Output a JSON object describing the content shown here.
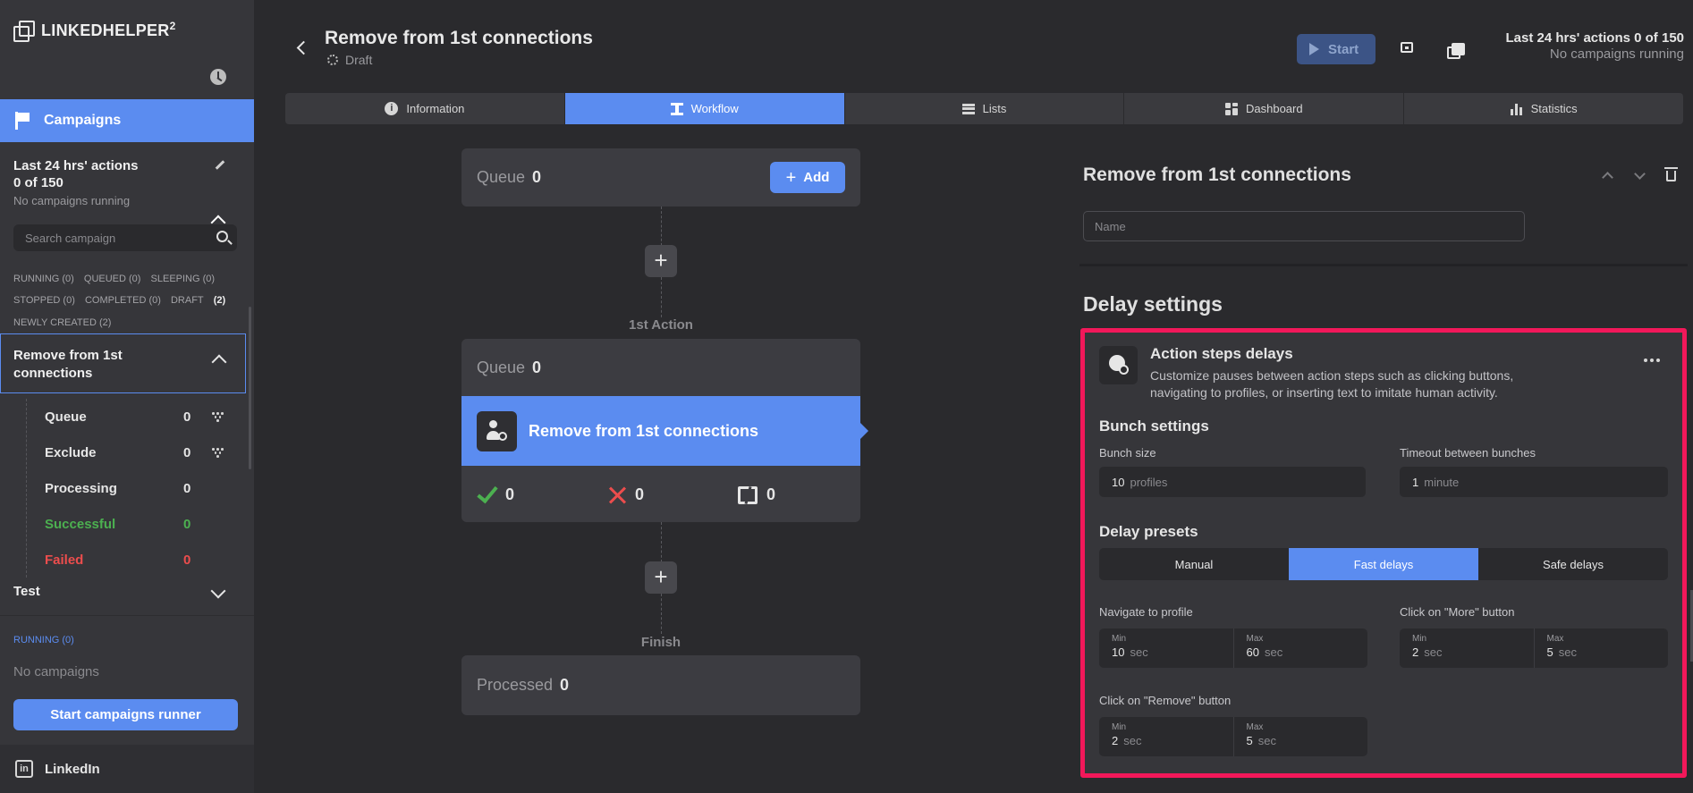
{
  "sidebar": {
    "logo": "LINKEDHELPER",
    "logo_sup": "2",
    "campaigns_label": "Campaigns",
    "stats_title": "Last 24 hrs' actions",
    "stats_count": "0 of 150",
    "stats_status": "No campaigns running",
    "search_placeholder": "Search campaign",
    "filters": {
      "running": "RUNNING (0)",
      "queued": "QUEUED (0)",
      "sleeping": "SLEEPING (0)",
      "stopped": "STOPPED (0)",
      "completed": "COMPLETED (0)",
      "draft": "DRAFT",
      "draft_count": "(2)"
    },
    "newly_created": "NEWLY CREATED (2)",
    "campaign_title": "Remove from 1st connections",
    "sub_items": [
      {
        "label": "Queue",
        "count": "0"
      },
      {
        "label": "Exclude",
        "count": "0"
      },
      {
        "label": "Processing",
        "count": "0"
      },
      {
        "label": "Successful",
        "count": "0"
      },
      {
        "label": "Failed",
        "count": "0"
      }
    ],
    "test_campaign": "Test",
    "running_label": "RUNNING (0)",
    "no_campaigns": "No campaigns",
    "runner_button": "Start campaigns runner",
    "linkedin_label": "LinkedIn",
    "linkedin_icon_text": "in"
  },
  "header": {
    "title": "Remove from 1st connections",
    "status": "Draft",
    "start_button": "Start",
    "stats_line1": "Last 24 hrs' actions 0 of 150",
    "stats_line2": "No campaigns running"
  },
  "tabs": [
    {
      "label": "Information",
      "icon": "info-icon"
    },
    {
      "label": "Workflow",
      "icon": "workflow-icon"
    },
    {
      "label": "Lists",
      "icon": "list-icon"
    },
    {
      "label": "Dashboard",
      "icon": "dashboard-icon"
    },
    {
      "label": "Statistics",
      "icon": "statistics-icon"
    }
  ],
  "workflow": {
    "queue_label": "Queue",
    "queue_value": "0",
    "add_button": "Add",
    "first_action_caption": "1st Action",
    "action_queue_label": "Queue",
    "action_queue_value": "0",
    "action_label": "Remove from 1st connections",
    "success_count": "0",
    "fail_count": "0",
    "skip_count": "0",
    "finish_caption": "Finish",
    "processed_label": "Processed",
    "processed_value": "0"
  },
  "panel": {
    "title": "Remove from 1st connections",
    "name_placeholder": "Name",
    "delay_heading": "Delay settings",
    "asd_title": "Action steps delays",
    "asd_description": "Customize pauses between action steps such as clicking buttons, navigating to profiles, or inserting text to imitate human activity.",
    "bunch_heading": "Bunch settings",
    "bunch_size_label": "Bunch size",
    "bunch_size_value": "10",
    "bunch_size_unit": "profiles",
    "timeout_label": "Timeout between bunches",
    "timeout_value": "1",
    "timeout_unit": "minute",
    "presets_heading": "Delay presets",
    "presets": [
      "Manual",
      "Fast delays",
      "Safe delays"
    ],
    "min_label": "Min",
    "max_label": "Max",
    "sec_unit": "sec",
    "navigate_label": "Navigate to profile",
    "navigate_min": "10",
    "navigate_max": "60",
    "more_label": "Click on \"More\" button",
    "more_min": "2",
    "more_max": "5",
    "remove_label": "Click on \"Remove\" button",
    "remove_min": "2",
    "remove_max": "5"
  },
  "colors": {
    "accent": "#5b8cf0",
    "highlight_border": "#f2185a",
    "success": "#4cb050",
    "failure": "#ec4d4d"
  }
}
